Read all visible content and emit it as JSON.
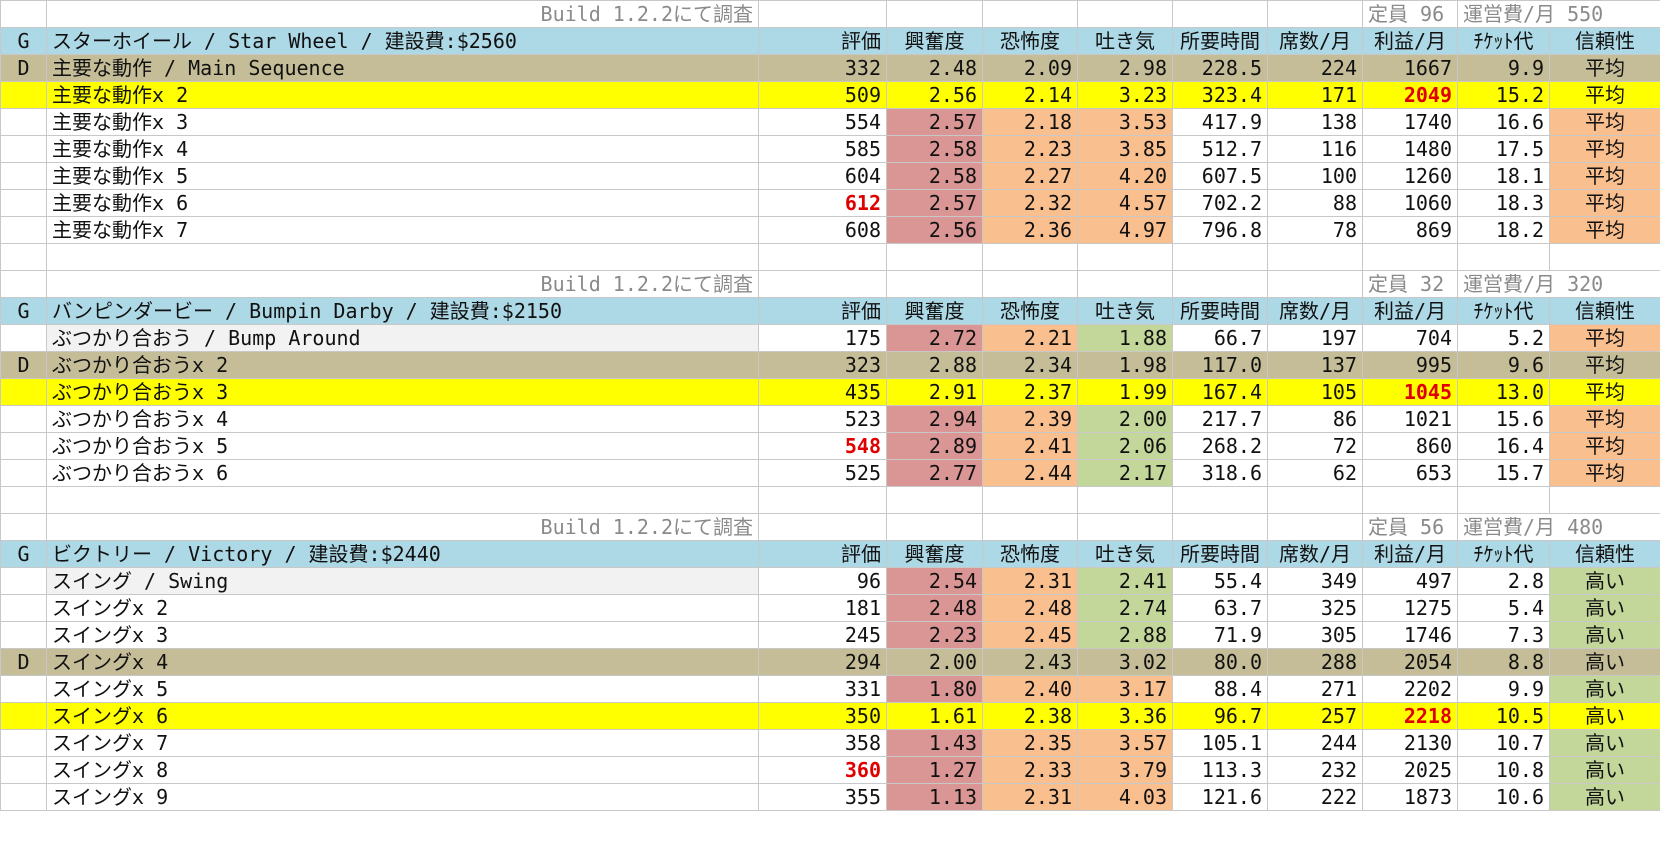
{
  "sections": [
    {
      "note_center": "Build 1.2.2にて調査",
      "note_staff": "定員 96",
      "note_cost": "運営費/月 550",
      "header": {
        "g": "G",
        "title": "スターホイール / Star Wheel / 建設費:$2560",
        "cols": [
          "評価",
          "興奮度",
          "恐怖度",
          "吐き気",
          "所要時間",
          "席数/月",
          "利益/月",
          "ﾁｹｯﾄ代",
          "信頼性"
        ]
      },
      "rows": [
        {
          "tag": "D",
          "name": "主要な動作 / Main Sequence",
          "rating": "332",
          "excite": "2.48",
          "fear": "2.09",
          "nausea": "2.98",
          "time": "228.5",
          "seats": "224",
          "profit": "1667",
          "ticket": "9.9",
          "rel": "平均",
          "kind": "d",
          "nauseaColor": "g",
          "relColor": "o",
          "ratingRed": false,
          "profitRed": false
        },
        {
          "tag": "",
          "name": "主要な動作x 2",
          "rating": "509",
          "excite": "2.56",
          "fear": "2.14",
          "nausea": "3.23",
          "time": "323.4",
          "seats": "171",
          "profit": "2049",
          "ticket": "15.2",
          "rel": "平均",
          "kind": "best",
          "nauseaColor": "o",
          "relColor": "o",
          "ratingRed": false,
          "profitRed": true
        },
        {
          "tag": "",
          "name": "主要な動作x 3",
          "rating": "554",
          "excite": "2.57",
          "fear": "2.18",
          "nausea": "3.53",
          "time": "417.9",
          "seats": "138",
          "profit": "1740",
          "ticket": "16.6",
          "rel": "平均",
          "kind": "",
          "nauseaColor": "o",
          "relColor": "o",
          "ratingRed": false,
          "profitRed": false
        },
        {
          "tag": "",
          "name": "主要な動作x 4",
          "rating": "585",
          "excite": "2.58",
          "fear": "2.23",
          "nausea": "3.85",
          "time": "512.7",
          "seats": "116",
          "profit": "1480",
          "ticket": "17.5",
          "rel": "平均",
          "kind": "",
          "nauseaColor": "o",
          "relColor": "o",
          "ratingRed": false,
          "profitRed": false
        },
        {
          "tag": "",
          "name": "主要な動作x 5",
          "rating": "604",
          "excite": "2.58",
          "fear": "2.27",
          "nausea": "4.20",
          "time": "607.5",
          "seats": "100",
          "profit": "1260",
          "ticket": "18.1",
          "rel": "平均",
          "kind": "",
          "nauseaColor": "o",
          "relColor": "o",
          "ratingRed": false,
          "profitRed": false
        },
        {
          "tag": "",
          "name": "主要な動作x 6",
          "rating": "612",
          "excite": "2.57",
          "fear": "2.32",
          "nausea": "4.57",
          "time": "702.2",
          "seats": "88",
          "profit": "1060",
          "ticket": "18.3",
          "rel": "平均",
          "kind": "",
          "nauseaColor": "o",
          "relColor": "o",
          "ratingRed": true,
          "profitRed": false
        },
        {
          "tag": "",
          "name": "主要な動作x 7",
          "rating": "608",
          "excite": "2.56",
          "fear": "2.36",
          "nausea": "4.97",
          "time": "796.8",
          "seats": "78",
          "profit": "869",
          "ticket": "18.2",
          "rel": "平均",
          "kind": "",
          "nauseaColor": "o",
          "relColor": "o",
          "ratingRed": false,
          "profitRed": false
        }
      ]
    },
    {
      "note_center": "Build 1.2.2にて調査",
      "note_staff": "定員 32",
      "note_cost": "運営費/月 320",
      "header": {
        "g": "G",
        "title": "バンピンダービー / Bumpin Darby / 建設費:$2150",
        "cols": [
          "評価",
          "興奮度",
          "恐怖度",
          "吐き気",
          "所要時間",
          "席数/月",
          "利益/月",
          "ﾁｹｯﾄ代",
          "信頼性"
        ]
      },
      "rows": [
        {
          "tag": "",
          "name": "ぶつかり合おう / Bump Around",
          "rating": "175",
          "excite": "2.72",
          "fear": "2.21",
          "nausea": "1.88",
          "time": "66.7",
          "seats": "197",
          "profit": "704",
          "ticket": "5.2",
          "rel": "平均",
          "kind": "grey",
          "nauseaColor": "g",
          "relColor": "o",
          "ratingRed": false,
          "profitRed": false
        },
        {
          "tag": "D",
          "name": "ぶつかり合おうx 2",
          "rating": "323",
          "excite": "2.88",
          "fear": "2.34",
          "nausea": "1.98",
          "time": "117.0",
          "seats": "137",
          "profit": "995",
          "ticket": "9.6",
          "rel": "平均",
          "kind": "d",
          "nauseaColor": "g",
          "relColor": "o",
          "ratingRed": false,
          "profitRed": false
        },
        {
          "tag": "",
          "name": "ぶつかり合おうx 3",
          "rating": "435",
          "excite": "2.91",
          "fear": "2.37",
          "nausea": "1.99",
          "time": "167.4",
          "seats": "105",
          "profit": "1045",
          "ticket": "13.0",
          "rel": "平均",
          "kind": "best",
          "nauseaColor": "g",
          "relColor": "o",
          "ratingRed": false,
          "profitRed": true
        },
        {
          "tag": "",
          "name": "ぶつかり合おうx 4",
          "rating": "523",
          "excite": "2.94",
          "fear": "2.39",
          "nausea": "2.00",
          "time": "217.7",
          "seats": "86",
          "profit": "1021",
          "ticket": "15.6",
          "rel": "平均",
          "kind": "",
          "nauseaColor": "g",
          "relColor": "o",
          "ratingRed": false,
          "profitRed": false
        },
        {
          "tag": "",
          "name": "ぶつかり合おうx 5",
          "rating": "548",
          "excite": "2.89",
          "fear": "2.41",
          "nausea": "2.06",
          "time": "268.2",
          "seats": "72",
          "profit": "860",
          "ticket": "16.4",
          "rel": "平均",
          "kind": "",
          "nauseaColor": "g",
          "relColor": "o",
          "ratingRed": true,
          "profitRed": false
        },
        {
          "tag": "",
          "name": "ぶつかり合おうx 6",
          "rating": "525",
          "excite": "2.77",
          "fear": "2.44",
          "nausea": "2.17",
          "time": "318.6",
          "seats": "62",
          "profit": "653",
          "ticket": "15.7",
          "rel": "平均",
          "kind": "",
          "nauseaColor": "g",
          "relColor": "o",
          "ratingRed": false,
          "profitRed": false
        }
      ]
    },
    {
      "note_center": "Build 1.2.2にて調査",
      "note_staff": "定員 56",
      "note_cost": "運営費/月 480",
      "header": {
        "g": "G",
        "title": "ビクトリー / Victory / 建設費:$2440",
        "cols": [
          "評価",
          "興奮度",
          "恐怖度",
          "吐き気",
          "所要時間",
          "席数/月",
          "利益/月",
          "ﾁｹｯﾄ代",
          "信頼性"
        ]
      },
      "rows": [
        {
          "tag": "",
          "name": "スイング / Swing",
          "rating": "96",
          "excite": "2.54",
          "fear": "2.31",
          "nausea": "2.41",
          "time": "55.4",
          "seats": "349",
          "profit": "497",
          "ticket": "2.8",
          "rel": "高い",
          "kind": "grey",
          "nauseaColor": "g",
          "relColor": "g",
          "ratingRed": false,
          "profitRed": false
        },
        {
          "tag": "",
          "name": "スイングx 2",
          "rating": "181",
          "excite": "2.48",
          "fear": "2.48",
          "nausea": "2.74",
          "time": "63.7",
          "seats": "325",
          "profit": "1275",
          "ticket": "5.4",
          "rel": "高い",
          "kind": "",
          "nauseaColor": "g",
          "relColor": "g",
          "ratingRed": false,
          "profitRed": false
        },
        {
          "tag": "",
          "name": "スイングx 3",
          "rating": "245",
          "excite": "2.23",
          "fear": "2.45",
          "nausea": "2.88",
          "time": "71.9",
          "seats": "305",
          "profit": "1746",
          "ticket": "7.3",
          "rel": "高い",
          "kind": "",
          "nauseaColor": "g",
          "relColor": "g",
          "ratingRed": false,
          "profitRed": false
        },
        {
          "tag": "D",
          "name": "スイングx 4",
          "rating": "294",
          "excite": "2.00",
          "fear": "2.43",
          "nausea": "3.02",
          "time": "80.0",
          "seats": "288",
          "profit": "2054",
          "ticket": "8.8",
          "rel": "高い",
          "kind": "d",
          "nauseaColor": "o",
          "relColor": "g",
          "ratingRed": false,
          "profitRed": false
        },
        {
          "tag": "",
          "name": "スイングx 5",
          "rating": "331",
          "excite": "1.80",
          "fear": "2.40",
          "nausea": "3.17",
          "time": "88.4",
          "seats": "271",
          "profit": "2202",
          "ticket": "9.9",
          "rel": "高い",
          "kind": "",
          "nauseaColor": "o",
          "relColor": "g",
          "ratingRed": false,
          "profitRed": false
        },
        {
          "tag": "",
          "name": "スイングx 6",
          "rating": "350",
          "excite": "1.61",
          "fear": "2.38",
          "nausea": "3.36",
          "time": "96.7",
          "seats": "257",
          "profit": "2218",
          "ticket": "10.5",
          "rel": "高い",
          "kind": "best",
          "nauseaColor": "o",
          "relColor": "g",
          "ratingRed": false,
          "profitRed": true
        },
        {
          "tag": "",
          "name": "スイングx 7",
          "rating": "358",
          "excite": "1.43",
          "fear": "2.35",
          "nausea": "3.57",
          "time": "105.1",
          "seats": "244",
          "profit": "2130",
          "ticket": "10.7",
          "rel": "高い",
          "kind": "",
          "nauseaColor": "o",
          "relColor": "g",
          "ratingRed": false,
          "profitRed": false
        },
        {
          "tag": "",
          "name": "スイングx 8",
          "rating": "360",
          "excite": "1.27",
          "fear": "2.33",
          "nausea": "3.79",
          "time": "113.3",
          "seats": "232",
          "profit": "2025",
          "ticket": "10.8",
          "rel": "高い",
          "kind": "",
          "nauseaColor": "o",
          "relColor": "g",
          "ratingRed": true,
          "profitRed": false
        },
        {
          "tag": "",
          "name": "スイングx 9",
          "rating": "355",
          "excite": "1.13",
          "fear": "2.31",
          "nausea": "4.03",
          "time": "121.6",
          "seats": "222",
          "profit": "1873",
          "ticket": "10.6",
          "rel": "高い",
          "kind": "",
          "nauseaColor": "o",
          "relColor": "g",
          "ratingRed": false,
          "profitRed": false
        }
      ]
    }
  ]
}
